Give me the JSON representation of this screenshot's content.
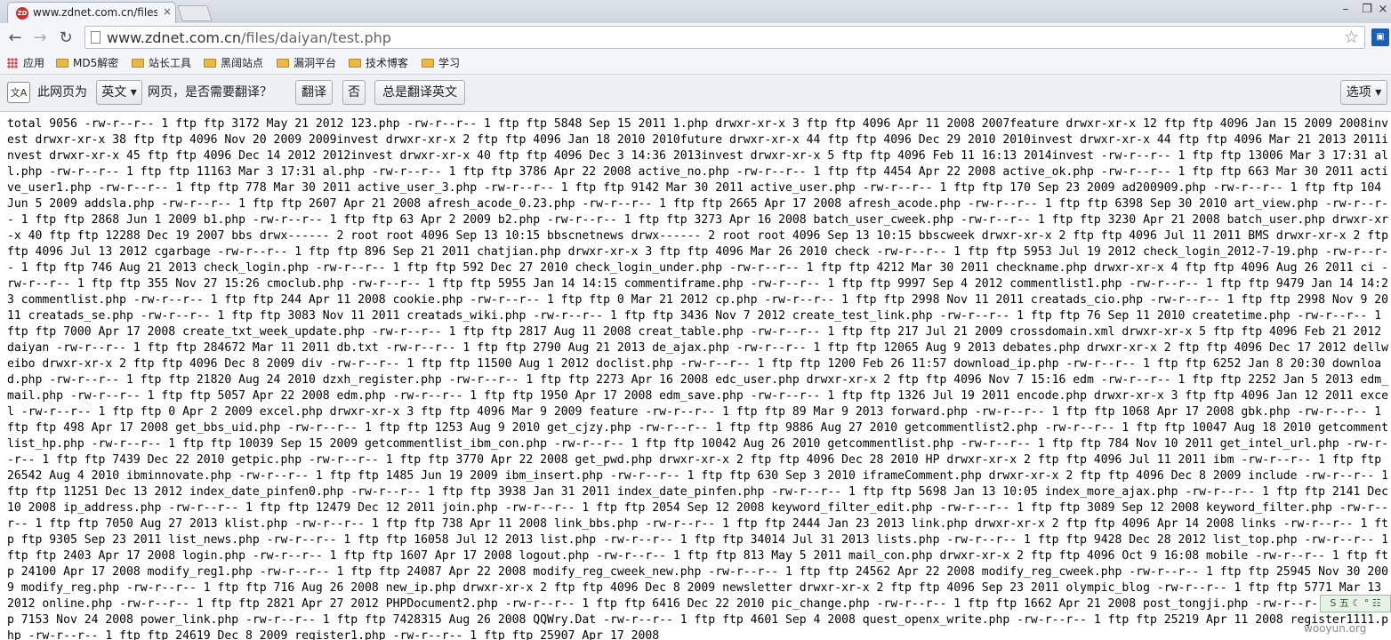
{
  "tab": {
    "title": "www.zdnet.com.cn/files/",
    "close_glyph": "×",
    "favicon_text": "ZD"
  },
  "window_controls": {
    "minimize": "–",
    "maximize": "❐",
    "close": "×"
  },
  "nav": {
    "back": "←",
    "forward": "→",
    "reload": "↻"
  },
  "omnibox": {
    "host": "www.zdnet.com.cn",
    "path": "/files/daiyan/test.php",
    "star": "☆"
  },
  "extension": {
    "label": "▣"
  },
  "bookmarks": {
    "items": [
      {
        "label": "应用",
        "type": "apps"
      },
      {
        "label": "MD5解密",
        "type": "folder"
      },
      {
        "label": "站长工具",
        "type": "folder"
      },
      {
        "label": "黑阔站点",
        "type": "folder"
      },
      {
        "label": "漏洞平台",
        "type": "folder"
      },
      {
        "label": "技术博客",
        "type": "folder"
      },
      {
        "label": "学习",
        "type": "folder"
      }
    ]
  },
  "translate_bar": {
    "icon": "文A",
    "prefix": "此网页为",
    "language": "英文",
    "question": "网页，是否需要翻译？",
    "translate_label": "翻译",
    "no_label": "否",
    "always_label": "总是翻译英文",
    "options_label": "选项"
  },
  "content": {
    "listing": "total 9056 -rw-r--r-- 1 ftp ftp 3172 May 21 2012 123.php -rw-r--r-- 1 ftp ftp 5848 Sep 15 2011 1.php drwxr-xr-x 3 ftp ftp 4096 Apr 11 2008 2007feature drwxr-xr-x 12 ftp ftp 4096 Jan 15 2009 2008invest drwxr-xr-x 38 ftp ftp 4096 Nov 20 2009 2009invest drwxr-xr-x 2 ftp ftp 4096 Jan 18 2010 2010future drwxr-xr-x 44 ftp ftp 4096 Dec 29 2010 2010invest drwxr-xr-x 44 ftp ftp 4096 Mar 21 2013 2011invest drwxr-xr-x 45 ftp ftp 4096 Dec 14 2012 2012invest drwxr-xr-x 40 ftp ftp 4096 Dec 3 14:36 2013invest drwxr-xr-x 5 ftp ftp 4096 Feb 11 16:13 2014invest -rw-r--r-- 1 ftp ftp 13006 Mar 3 17:31 all.php -rw-r--r-- 1 ftp ftp 11163 Mar 3 17:31 al.php -rw-r--r-- 1 ftp ftp 3786 Apr 22 2008 active_no.php -rw-r--r-- 1 ftp ftp 4454 Apr 22 2008 active_ok.php -rw-r--r-- 1 ftp ftp 663 Mar 30 2011 active_user1.php -rw-r--r-- 1 ftp ftp 778 Mar 30 2011 active_user_3.php -rw-r--r-- 1 ftp ftp 9142 Mar 30 2011 active_user.php -rw-r--r-- 1 ftp ftp 170 Sep 23 2009 ad200909.php -rw-r--r-- 1 ftp ftp 104 Jun 5 2009 addsla.php -rw-r--r-- 1 ftp ftp 2607 Apr 21 2008 afresh_acode_0.23.php -rw-r--r-- 1 ftp ftp 2665 Apr 17 2008 afresh_acode.php -rw-r--r-- 1 ftp ftp 6398 Sep 30 2010 art_view.php -rw-r--r-- 1 ftp ftp 2868 Jun 1 2009 b1.php -rw-r--r-- 1 ftp ftp 63 Apr 2 2009 b2.php -rw-r--r-- 1 ftp ftp 3273 Apr 16 2008 batch_user_cweek.php -rw-r--r-- 1 ftp ftp 3230 Apr 21 2008 batch_user.php drwxr-xr-x 40 ftp ftp 12288 Dec 19 2007 bbs drwx------ 2 root root 4096 Sep 13 10:15 bbscnetnews drwx------ 2 root root 4096 Sep 13 10:15 bbscweek drwxr-xr-x 2 ftp ftp 4096 Jul 11 2011 BMS drwxr-xr-x 2 ftp ftp 4096 Jul 13 2012 cgarbage -rw-r--r-- 1 ftp ftp 896 Sep 21 2011 chatjian.php drwxr-xr-x 3 ftp ftp 4096 Mar 26 2010 check -rw-r--r-- 1 ftp ftp 5953 Jul 19 2012 check_login_2012-7-19.php -rw-r--r-- 1 ftp ftp 746 Aug 21 2013 check_login.php -rw-r--r-- 1 ftp ftp 592 Dec 27 2010 check_login_under.php -rw-r--r-- 1 ftp ftp 4212 Mar 30 2011 checkname.php drwxr-xr-x 4 ftp ftp 4096 Aug 26 2011 ci -rw-r--r-- 1 ftp ftp 355 Nov 27 15:26 cmoclub.php -rw-r--r-- 1 ftp ftp 5955 Jan 14 14:15 commentiframe.php -rw-r--r-- 1 ftp ftp 9997 Sep 4 2012 commentlist1.php -rw-r--r-- 1 ftp ftp 9479 Jan 14 14:23 commentlist.php -rw-r--r-- 1 ftp ftp 244 Apr 11 2008 cookie.php -rw-r--r-- 1 ftp ftp 0 Mar 21 2012 cp.php -rw-r--r-- 1 ftp ftp 2998 Nov 11 2011 creatads_cio.php -rw-r--r-- 1 ftp ftp 2998 Nov 9 2011 creatads_se.php -rw-r--r-- 1 ftp ftp 3083 Nov 11 2011 creatads_wiki.php -rw-r--r-- 1 ftp ftp 3436 Nov 7 2012 create_test_link.php -rw-r--r-- 1 ftp ftp 76 Sep 11 2010 createtime.php -rw-r--r-- 1 ftp ftp 7000 Apr 17 2008 create_txt_week_update.php -rw-r--r-- 1 ftp ftp 2817 Aug 11 2008 creat_table.php -rw-r--r-- 1 ftp ftp 217 Jul 21 2009 crossdomain.xml drwxr-xr-x 5 ftp ftp 4096 Feb 21 2012 daiyan -rw-r--r-- 1 ftp ftp 284672 Mar 11 2011 db.txt -rw-r--r-- 1 ftp ftp 2790 Aug 21 2013 de_ajax.php -rw-r--r-- 1 ftp ftp 12065 Aug 9 2013 debates.php drwxr-xr-x 2 ftp ftp 4096 Dec 17 2012 dellweibo drwxr-xr-x 2 ftp ftp 4096 Dec 8 2009 div -rw-r--r-- 1 ftp ftp 11500 Aug 1 2012 doclist.php -rw-r--r-- 1 ftp ftp 1200 Feb 26 11:57 download_ip.php -rw-r--r-- 1 ftp ftp 6252 Jan 8 20:30 download.php -rw-r--r-- 1 ftp ftp 21820 Aug 24 2010 dzxh_register.php -rw-r--r-- 1 ftp ftp 2273 Apr 16 2008 edc_user.php drwxr-xr-x 2 ftp ftp 4096 Nov 7 15:16 edm -rw-r--r-- 1 ftp ftp 2252 Jan 5 2013 edm_mail.php -rw-r--r-- 1 ftp ftp 5057 Apr 22 2008 edm.php -rw-r--r-- 1 ftp ftp 1950 Apr 17 2008 edm_save.php -rw-r--r-- 1 ftp ftp 1326 Jul 19 2011 encode.php drwxr-xr-x 3 ftp ftp 4096 Jan 12 2011 excel -rw-r--r-- 1 ftp ftp 0 Apr 2 2009 excel.php drwxr-xr-x 3 ftp ftp 4096 Mar 9 2009 feature -rw-r--r-- 1 ftp ftp 89 Mar 9 2013 forward.php -rw-r--r-- 1 ftp ftp 1068 Apr 17 2008 gbk.php -rw-r--r-- 1 ftp ftp 498 Apr 17 2008 get_bbs_uid.php -rw-r--r-- 1 ftp ftp 1253 Aug 9 2010 get_cjzy.php -rw-r--r-- 1 ftp ftp 9886 Aug 27 2010 getcommentlist2.php -rw-r--r-- 1 ftp ftp 10047 Aug 18 2010 getcommentlist_hp.php -rw-r--r-- 1 ftp ftp 10039 Sep 15 2009 getcommentlist_ibm_con.php -rw-r--r-- 1 ftp ftp 10042 Aug 26 2010 getcommentlist.php -rw-r--r-- 1 ftp ftp 784 Nov 10 2011 get_intel_url.php -rw-r--r-- 1 ftp ftp 7439 Dec 22 2010 getpic.php -rw-r--r-- 1 ftp ftp 3770 Apr 22 2008 get_pwd.php drwxr-xr-x 2 ftp ftp 4096 Dec 28 2010 HP drwxr-xr-x 2 ftp ftp 4096 Jul 11 2011 ibm -rw-r--r-- 1 ftp ftp 26542 Aug 4 2010 ibminnovate.php -rw-r--r-- 1 ftp ftp 1485 Jun 19 2009 ibm_insert.php -rw-r--r-- 1 ftp ftp 630 Sep 3 2010 iframeComment.php drwxr-xr-x 2 ftp ftp 4096 Dec 8 2009 include -rw-r--r-- 1 ftp ftp 11251 Dec 13 2012 index_date_pinfen0.php -rw-r--r-- 1 ftp ftp 3938 Jan 31 2011 index_date_pinfen.php -rw-r--r-- 1 ftp ftp 5698 Jan 13 10:05 index_more_ajax.php -rw-r--r-- 1 ftp ftp 2141 Dec 10 2008 ip_address.php -rw-r--r-- 1 ftp ftp 12479 Dec 12 2011 join.php -rw-r--r-- 1 ftp ftp 2054 Sep 12 2008 keyword_filter_edit.php -rw-r--r-- 1 ftp ftp 3089 Sep 12 2008 keyword_filter.php -rw-r--r-- 1 ftp ftp 7050 Aug 27 2013 klist.php -rw-r--r-- 1 ftp ftp 738 Apr 11 2008 link_bbs.php -rw-r--r-- 1 ftp ftp 2444 Jan 23 2013 link.php drwxr-xr-x 2 ftp ftp 4096 Apr 14 2008 links -rw-r--r-- 1 ftp ftp 9305 Sep 23 2011 list_news.php -rw-r--r-- 1 ftp ftp 16058 Jul 12 2013 list.php -rw-r--r-- 1 ftp ftp 34014 Jul 31 2013 lists.php -rw-r--r-- 1 ftp ftp 9428 Dec 28 2012 list_top.php -rw-r--r-- 1 ftp ftp 2403 Apr 17 2008 login.php -rw-r--r-- 1 ftp ftp 1607 Apr 17 2008 logout.php -rw-r--r-- 1 ftp ftp 813 May 5 2011 mail_con.php drwxr-xr-x 2 ftp ftp 4096 Oct 9 16:08 mobile -rw-r--r-- 1 ftp ftp 24100 Apr 17 2008 modify_reg1.php -rw-r--r-- 1 ftp ftp 24087 Apr 22 2008 modify_reg_cweek_new.php -rw-r--r-- 1 ftp ftp 24562 Apr 22 2008 modify_reg_cweek.php -rw-r--r-- 1 ftp ftp 25945 Nov 30 2009 modify_reg.php -rw-r--r-- 1 ftp ftp 716 Aug 26 2008 new_ip.php drwxr-xr-x 2 ftp ftp 4096 Dec 8 2009 newsletter drwxr-xr-x 2 ftp ftp 4096 Sep 23 2011 olympic_blog -rw-r--r-- 1 ftp ftp 5771 Mar 13 2012 online.php -rw-r--r-- 1 ftp ftp 2821 Apr 27 2012 PHPDocument2.php -rw-r--r-- 1 ftp ftp 6416 Dec 22 2010 pic_change.php -rw-r--r-- 1 ftp ftp 1662 Apr 21 2008 post_tongji.php -rw-r--r-- 1 ftp ftp 7153 Nov 24 2008 power_link.php -rw-r--r-- 1 ftp ftp 7428315 Aug 26 2008 QQWry.Dat -rw-r--r-- 1 ftp ftp 4601 Sep 4 2008 quest_openx_write.php -rw-r--r-- 1 ftp ftp 25219 Apr 11 2008 register1111.php -rw-r--r-- 1 ftp ftp 24619 Dec 8 2009 register1.php -rw-r--r-- 1 ftp ftp 25907 Apr 17 2008"
  },
  "tray": {
    "label": "S 五 ☾ ° ☷"
  },
  "watermark": {
    "text": "wooyun.org"
  }
}
